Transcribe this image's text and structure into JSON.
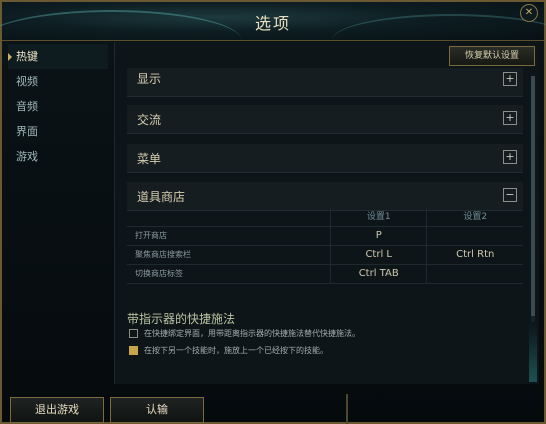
{
  "window": {
    "title": "选项",
    "close_label": "✕"
  },
  "sidebar": {
    "items": [
      {
        "label": "热键",
        "active": true
      },
      {
        "label": "视频",
        "active": false
      },
      {
        "label": "音频",
        "active": false
      },
      {
        "label": "界面",
        "active": false
      },
      {
        "label": "游戏",
        "active": false
      }
    ]
  },
  "main": {
    "reset_label": "恢复默认设置",
    "sections": [
      {
        "label": "显示",
        "toggle": "+"
      },
      {
        "label": "交流",
        "toggle": "+"
      },
      {
        "label": "菜单",
        "toggle": "+"
      },
      {
        "label": "道具商店",
        "toggle": "−"
      }
    ],
    "bind_table": {
      "headers": [
        "",
        "设置1",
        "设置2"
      ],
      "rows": [
        [
          "打开商店",
          "P",
          ""
        ],
        [
          "聚焦商店搜索栏",
          "Ctrl  L",
          "Ctrl  Rtn"
        ],
        [
          "切换商店标签",
          "Ctrl  TAB",
          ""
        ]
      ]
    },
    "quickcast": {
      "title": "带指示器的快捷施法",
      "options": [
        {
          "label": "在快捷绑定界面，用带距离指示器的快捷施法替代快捷施法。",
          "checked": false
        },
        {
          "label": "在按下另一个技能时，施放上一个已经按下的技能。",
          "checked": true
        }
      ]
    }
  },
  "footer": {
    "exit_label": "退出游戏",
    "surrender_label": "认输"
  }
}
